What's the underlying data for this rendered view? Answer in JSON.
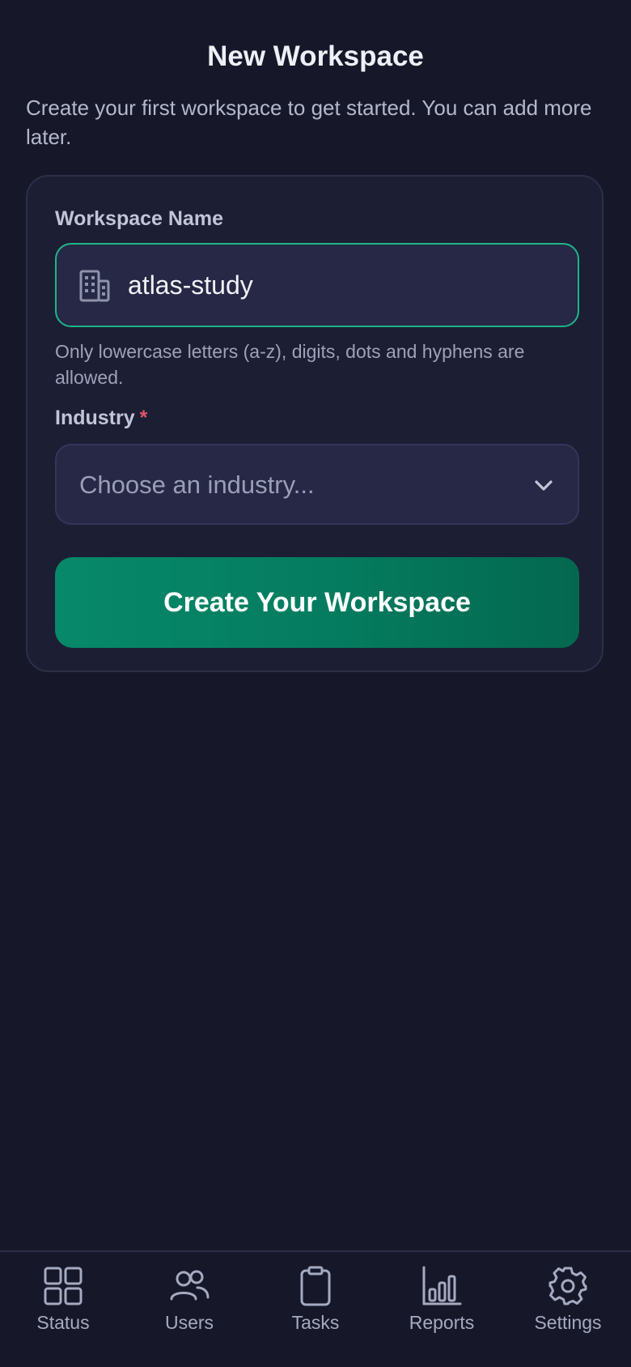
{
  "header": {
    "title": "New Workspace",
    "subtitle": "Create your first workspace to get started. You can add more later."
  },
  "form": {
    "workspace_name": {
      "label": "Workspace Name",
      "value": "atlas-study",
      "icon": "building-icon",
      "helper": "Only lowercase letters (a-z), digits, dots and hyphens are allowed."
    },
    "industry": {
      "label": "Industry",
      "required_mark": "*",
      "placeholder": "Choose an industry...",
      "icon": "chevron-down-icon"
    },
    "submit_label": "Create Your Workspace"
  },
  "tabbar": {
    "items": [
      {
        "label": "Status",
        "icon": "grid-icon"
      },
      {
        "label": "Users",
        "icon": "users-icon"
      },
      {
        "label": "Tasks",
        "icon": "clipboard-icon"
      },
      {
        "label": "Reports",
        "icon": "bar-chart-icon"
      },
      {
        "label": "Settings",
        "icon": "gear-icon"
      }
    ]
  },
  "colors": {
    "background": "#161829",
    "card": "#1c1e33",
    "accent": "#1fb48a",
    "button": "#07896a",
    "required": "#e0556a"
  }
}
